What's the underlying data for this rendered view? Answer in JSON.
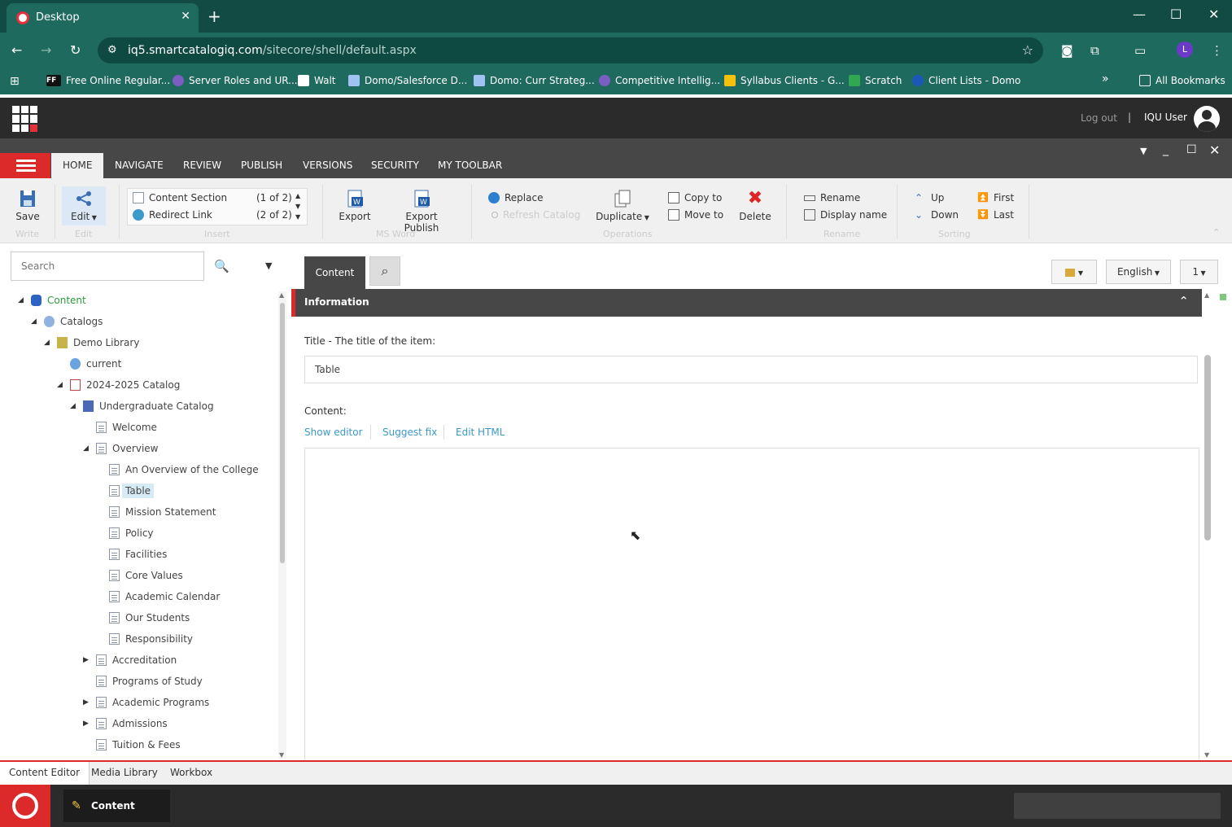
{
  "browser": {
    "tab_title": "Desktop",
    "url_domain": "iq5.smartcatalogiq.com",
    "url_path": "/sitecore/shell/default.aspx",
    "profile_initial": "L",
    "bookmarks": [
      "Free Online Regular...",
      "Server Roles and UR...",
      "Walt",
      "Domo/Salesforce D...",
      "Domo: Curr Strateg...",
      "Competitive Intellig...",
      "Syllabus Clients - G...",
      "Scratch",
      "Client Lists - Domo"
    ],
    "ff_badge": "FF",
    "bookmarks_overflow": "»",
    "all_bookmarks": "All Bookmarks"
  },
  "header": {
    "logout": "Log out",
    "separator": "|",
    "user": "IQU User"
  },
  "ribbon": {
    "tabs": [
      "HOME",
      "NAVIGATE",
      "REVIEW",
      "PUBLISH",
      "VERSIONS",
      "SECURITY",
      "MY TOOLBAR"
    ],
    "save": "Save",
    "edit": "Edit",
    "insert_items": [
      {
        "label": "Content Section",
        "count": "(1 of 2)"
      },
      {
        "label": "Redirect Link",
        "count": "(2 of 2)"
      }
    ],
    "export": "Export",
    "export_publish": "Export Publish",
    "replace": "Replace",
    "refresh_catalog": "Refresh Catalog",
    "duplicate": "Duplicate",
    "copy_to": "Copy to",
    "move_to": "Move to",
    "delete": "Delete",
    "rename": "Rename",
    "display_name": "Display name",
    "up": "Up",
    "down": "Down",
    "first": "First",
    "last": "Last",
    "groups": [
      "Write",
      "Edit",
      "Insert",
      "MS Word",
      "Operations",
      "Rename",
      "Sorting"
    ],
    "colors": {
      "accent": "#dc2a2a",
      "dark": "#474747"
    }
  },
  "search": {
    "placeholder": "Search"
  },
  "tree": [
    {
      "label": "Content",
      "level": 0,
      "toggle": "open",
      "icon": "content-icon"
    },
    {
      "label": "Catalogs",
      "level": 1,
      "toggle": "open",
      "icon": "catalogs-icon"
    },
    {
      "label": "Demo Library",
      "level": 2,
      "toggle": "open",
      "icon": "library-icon"
    },
    {
      "label": "current",
      "level": 3,
      "toggle": "none",
      "icon": "link-icon"
    },
    {
      "label": "2024-2025 Catalog",
      "level": 3,
      "toggle": "open",
      "icon": "calendar-icon"
    },
    {
      "label": "Undergraduate Catalog",
      "level": 4,
      "toggle": "open",
      "icon": "book-icon"
    },
    {
      "label": "Welcome",
      "level": 5,
      "toggle": "none",
      "icon": "page-icon"
    },
    {
      "label": "Overview",
      "level": 5,
      "toggle": "open",
      "icon": "page-icon"
    },
    {
      "label": "An Overview of the College",
      "level": 6,
      "toggle": "none",
      "icon": "page-icon"
    },
    {
      "label": "Table",
      "level": 6,
      "toggle": "none",
      "icon": "page-icon",
      "selected": true
    },
    {
      "label": "Mission Statement",
      "level": 6,
      "toggle": "none",
      "icon": "page-icon"
    },
    {
      "label": "Policy",
      "level": 6,
      "toggle": "none",
      "icon": "page-icon"
    },
    {
      "label": "Facilities",
      "level": 6,
      "toggle": "none",
      "icon": "page-icon"
    },
    {
      "label": "Core Values",
      "level": 6,
      "toggle": "none",
      "icon": "page-icon"
    },
    {
      "label": "Academic Calendar",
      "level": 6,
      "toggle": "none",
      "icon": "page-icon"
    },
    {
      "label": "Our Students",
      "level": 6,
      "toggle": "none",
      "icon": "page-icon"
    },
    {
      "label": "Responsibility",
      "level": 6,
      "toggle": "none",
      "icon": "page-icon"
    },
    {
      "label": "Accreditation",
      "level": 5,
      "toggle": "closed",
      "icon": "page-icon"
    },
    {
      "label": "Programs of Study",
      "level": 5,
      "toggle": "none",
      "icon": "page-icon"
    },
    {
      "label": "Academic Programs",
      "level": 5,
      "toggle": "closed",
      "icon": "page-icon"
    },
    {
      "label": "Admissions",
      "level": 5,
      "toggle": "closed",
      "icon": "page-icon"
    },
    {
      "label": "Tuition & Fees",
      "level": 5,
      "toggle": "none",
      "icon": "page-icon"
    }
  ],
  "editor": {
    "content_tab": "Content",
    "language": "English",
    "version": "1",
    "section_title": "Information",
    "title_label": "Title - The title of the item:",
    "title_value": "Table",
    "content_label": "Content:",
    "links": [
      "Show editor",
      "Suggest fix",
      "Edit HTML"
    ]
  },
  "bottom": {
    "tabs": [
      "Content Editor",
      "Media Library",
      "Workbox"
    ],
    "task_item": "Content Editor"
  }
}
